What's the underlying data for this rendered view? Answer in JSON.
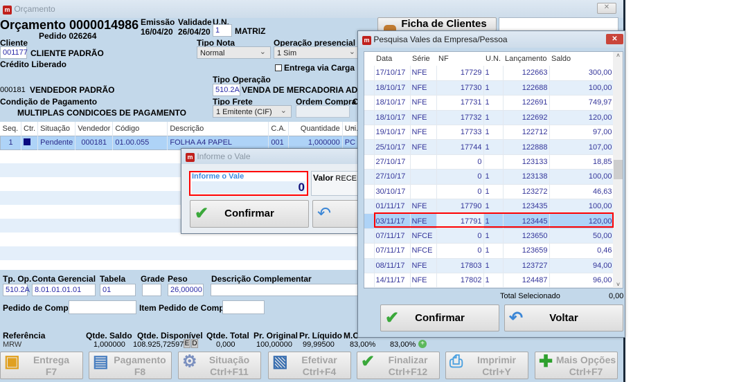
{
  "window": {
    "title": "Orçamento",
    "close": "✕"
  },
  "header": {
    "title": "Orçamento 0000014986",
    "pedido": "Pedido 026264",
    "emissao_label": "Emissão",
    "emissao": "16/04/20",
    "validade_label": "Validade",
    "validade": "26/04/20",
    "un_label": "U.N.",
    "un": "1",
    "un_name": "MATRIZ",
    "ficha_clientes": "Ficha de Clientes"
  },
  "cliente": {
    "label": "Cliente",
    "code": "001177",
    "name": "CLIENTE PADRÃO",
    "credito": "Crédito Liberado"
  },
  "tipo_nota": {
    "label": "Tipo Nota",
    "value": "Normal"
  },
  "operacao_presencial": {
    "label": "Operação presencial",
    "value": "1 Sim"
  },
  "entrega_via_carga": {
    "label": "Entrega via Carga",
    "checked": false
  },
  "vendedor": {
    "code": "000181",
    "name": "VENDEDOR PADRÃO"
  },
  "tipo_operacao": {
    "label": "Tipo Operação",
    "code": "510.2A",
    "name": "VENDA DE MERCADORIA ADQUIRI"
  },
  "condicao": {
    "label": "Condição de Pagamento",
    "value": "MULTIPLAS CONDICOES DE PAGAMENTO"
  },
  "tipo_frete": {
    "label": "Tipo Frete",
    "value": "1 Emitente (CIF)"
  },
  "ordem_compra": {
    "label": "Ordem Compra",
    "label2": "O"
  },
  "grid": {
    "columns": [
      "Seq.",
      "Ctr.",
      "Situação",
      "Vendedor",
      "Código",
      "Descrição",
      "C.A.",
      "Quantidade",
      "Uni.",
      "C"
    ],
    "rows": [
      {
        "seq": "1",
        "situacao": "Pendente",
        "vendedor": "000181",
        "codigo": "01.00.055",
        "descricao": "FOLHA A4 PAPEL",
        "ca": "001",
        "quantidade": "1,000000",
        "uni": "PC"
      }
    ]
  },
  "fields": {
    "tp_op_label": "Tp. Op.",
    "tp_op": "510.2A",
    "conta_label": "Conta Gerencial",
    "conta": "8.01.01.01.01",
    "tabela_label": "Tabela",
    "tabela": "01",
    "grade_label": "Grade",
    "peso_label": "Peso",
    "peso": "26,00000",
    "desc_label": "Descrição Complementar",
    "pedido_compra_label": "Pedido de Compra",
    "item_pedido_label": "Item Pedido de Compra"
  },
  "totals": {
    "referencia_label": "Referência",
    "referencia": "MRW",
    "saldo_label": "Qtde. Saldo",
    "saldo": "1,000000",
    "disp_label": "Qtde. Disponível",
    "disp": "108.925,725976",
    "e": "E",
    "d": "D",
    "total_label": "Qtde. Total",
    "total": "0,000",
    "orig_label": "Pr. Original",
    "orig": "100,00000",
    "liq_label": "Pr. Líquido",
    "liq": "99,99500",
    "mc_label": "M.C",
    "mc1": "83,00%",
    "mc2": "83,00%"
  },
  "toolbar": [
    {
      "label": "Entrega",
      "key": "F7",
      "icon": "box-icon"
    },
    {
      "label": "Pagamento",
      "key": "F8",
      "icon": "cash-register-icon"
    },
    {
      "label": "Situação",
      "key": "Ctrl+F11",
      "icon": "gear-check-icon"
    },
    {
      "label": "Efetivar",
      "key": "Ctrl+F4",
      "icon": "document-check-icon"
    },
    {
      "label": "Finalizar",
      "key": "Ctrl+F12",
      "icon": "checkmark-icon"
    },
    {
      "label": "Imprimir",
      "key": "Ctrl+Y",
      "icon": "printer-icon"
    },
    {
      "label": "Mais Opções",
      "key": "Ctrl+F7",
      "icon": "plus-icon"
    }
  ],
  "vale_dialog": {
    "title": "Informe o Vale",
    "input_label": "Informe o Vale",
    "input_value": "0",
    "valor_label": "Valor",
    "valor_text": "RECEB",
    "confirm": "Confirmar"
  },
  "vales": {
    "title": "Pesquisa Vales da Empresa/Pessoa",
    "close": "✕",
    "columns": [
      "Data",
      "Série",
      "NF",
      "U.N.",
      "Lançamento",
      "Saldo"
    ],
    "rows": [
      [
        "17/10/17",
        "NFE",
        "17729",
        "1",
        "122663",
        "300,00"
      ],
      [
        "18/10/17",
        "NFE",
        "17730",
        "1",
        "122688",
        "100,00"
      ],
      [
        "18/10/17",
        "NFE",
        "17731",
        "1",
        "122691",
        "749,97"
      ],
      [
        "18/10/17",
        "NFE",
        "17732",
        "1",
        "122692",
        "120,00"
      ],
      [
        "19/10/17",
        "NFE",
        "17733",
        "1",
        "122712",
        "97,00"
      ],
      [
        "25/10/17",
        "NFE",
        "17744",
        "1",
        "122888",
        "107,00"
      ],
      [
        "27/10/17",
        "",
        "0",
        "",
        "123133",
        "18,85"
      ],
      [
        "27/10/17",
        "",
        "0",
        "1",
        "123138",
        "100,00"
      ],
      [
        "30/10/17",
        "",
        "0",
        "1",
        "123272",
        "46,63"
      ],
      [
        "01/11/17",
        "NFE",
        "17790",
        "1",
        "123435",
        "100,00"
      ],
      [
        "03/11/17",
        "NFE",
        "17791",
        "1",
        "123445",
        "120,00"
      ],
      [
        "07/11/17",
        "NFCE",
        "0",
        "1",
        "123650",
        "50,00"
      ],
      [
        "07/11/17",
        "NFCE",
        "0",
        "1",
        "123659",
        "0,46"
      ],
      [
        "08/11/17",
        "NFE",
        "17803",
        "1",
        "123727",
        "94,00"
      ],
      [
        "14/11/17",
        "NFE",
        "17802",
        "1",
        "124487",
        "96,00"
      ]
    ],
    "selected_index": 10,
    "total_label": "Total Selecionado",
    "total": "0,00",
    "confirm": "Confirmar",
    "back": "Voltar"
  },
  "colors": {
    "highlight": "#ff0000",
    "text_blue": "#34359a",
    "bg": "#c3d8ea"
  }
}
